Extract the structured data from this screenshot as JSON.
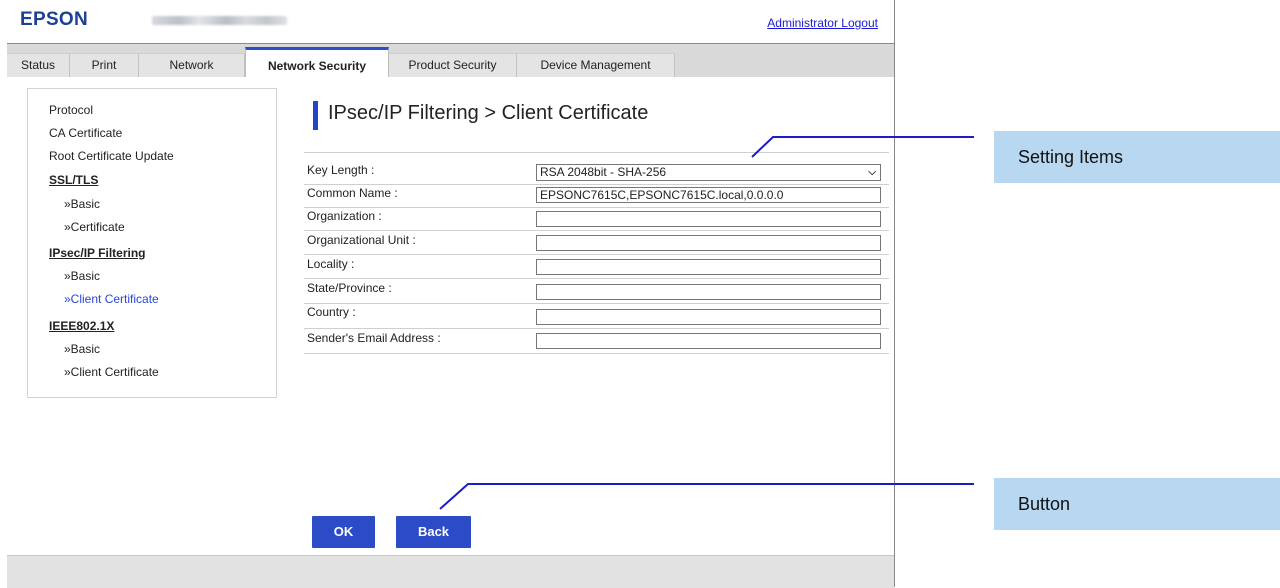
{
  "header": {
    "logo": "EPSON",
    "logout_label": "Administrator Logout"
  },
  "tabs": [
    {
      "label": "Status"
    },
    {
      "label": "Print"
    },
    {
      "label": "Network"
    },
    {
      "label": "Network Security",
      "active": true
    },
    {
      "label": "Product Security"
    },
    {
      "label": "Device Management"
    }
  ],
  "sidebar": {
    "items": [
      {
        "label": "Protocol"
      },
      {
        "label": "CA Certificate"
      },
      {
        "label": "Root Certificate Update"
      },
      {
        "label": "SSL/TLS"
      },
      {
        "label": "»Basic"
      },
      {
        "label": "»Certificate"
      },
      {
        "label": "IPsec/IP Filtering"
      },
      {
        "label": "»Basic"
      },
      {
        "label": "»Client Certificate"
      },
      {
        "label": "IEEE802.1X"
      },
      {
        "label": "»Basic"
      },
      {
        "label": "»Client Certificate"
      }
    ]
  },
  "page": {
    "title": "IPsec/IP Filtering > Client Certificate"
  },
  "form": {
    "rows": [
      {
        "label": "Key Length :",
        "value": "RSA 2048bit - SHA-256"
      },
      {
        "label": "Common Name :",
        "value": "EPSONC7615C,EPSONC7615C.local,0.0.0.0"
      },
      {
        "label": "Organization :",
        "value": ""
      },
      {
        "label": "Organizational Unit :",
        "value": ""
      },
      {
        "label": "Locality :",
        "value": ""
      },
      {
        "label": "State/Province :",
        "value": ""
      },
      {
        "label": "Country :",
        "value": ""
      },
      {
        "label": "Sender's Email Address :",
        "value": ""
      }
    ]
  },
  "buttons": {
    "ok_label": "OK",
    "back_label": "Back"
  },
  "annotations": {
    "setting_items": "Setting Items",
    "button": "Button"
  },
  "colors": {
    "accent": "#2c4bc6",
    "callout_fill": "#b8d8f2",
    "leader_line": "#1c1cc8"
  }
}
